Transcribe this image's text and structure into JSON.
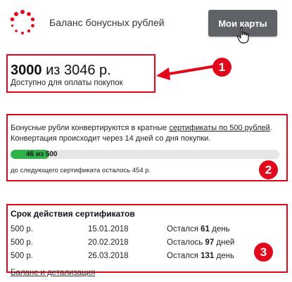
{
  "header": {
    "title": "Баланс бонусных рублей",
    "cards_button": "Мои карты",
    "logo_icon": "dots-ring-logo-icon",
    "accent_color": "#e2081c"
  },
  "balance": {
    "amount": "3000",
    "of_text": "из 3046 р.",
    "subtitle": "Доступно для оплаты покупок"
  },
  "conversion": {
    "text_before": "Бонусные рубли конвертируются в кратные ",
    "link_text": "сертификаты по 500 рублей",
    "text_after": ". Конвертация происходит через 14 дней со дня покупки.",
    "progress_current": "46",
    "progress_of": "из",
    "progress_total": "500",
    "progress_fraction": 0.092,
    "remaining": "до следующего сертификата осталось 454 р."
  },
  "certificates": {
    "title": "Срок действия сертификатов",
    "rows": [
      {
        "amount": "500 р.",
        "date": "15.01.2018",
        "left_prefix": "Остался",
        "days": "61",
        "left_suffix": "день"
      },
      {
        "amount": "500 р.",
        "date": "20.02.2018",
        "left_prefix": "Осталось",
        "days": "97",
        "left_suffix": "дней"
      },
      {
        "amount": "500 р.",
        "date": "26.03.2018",
        "left_prefix": "Остался",
        "days": "131",
        "left_suffix": "день"
      }
    ],
    "details_link": "Баланс и детализация"
  },
  "annotations": {
    "badge1": "1",
    "badge2": "2",
    "badge3": "3"
  }
}
